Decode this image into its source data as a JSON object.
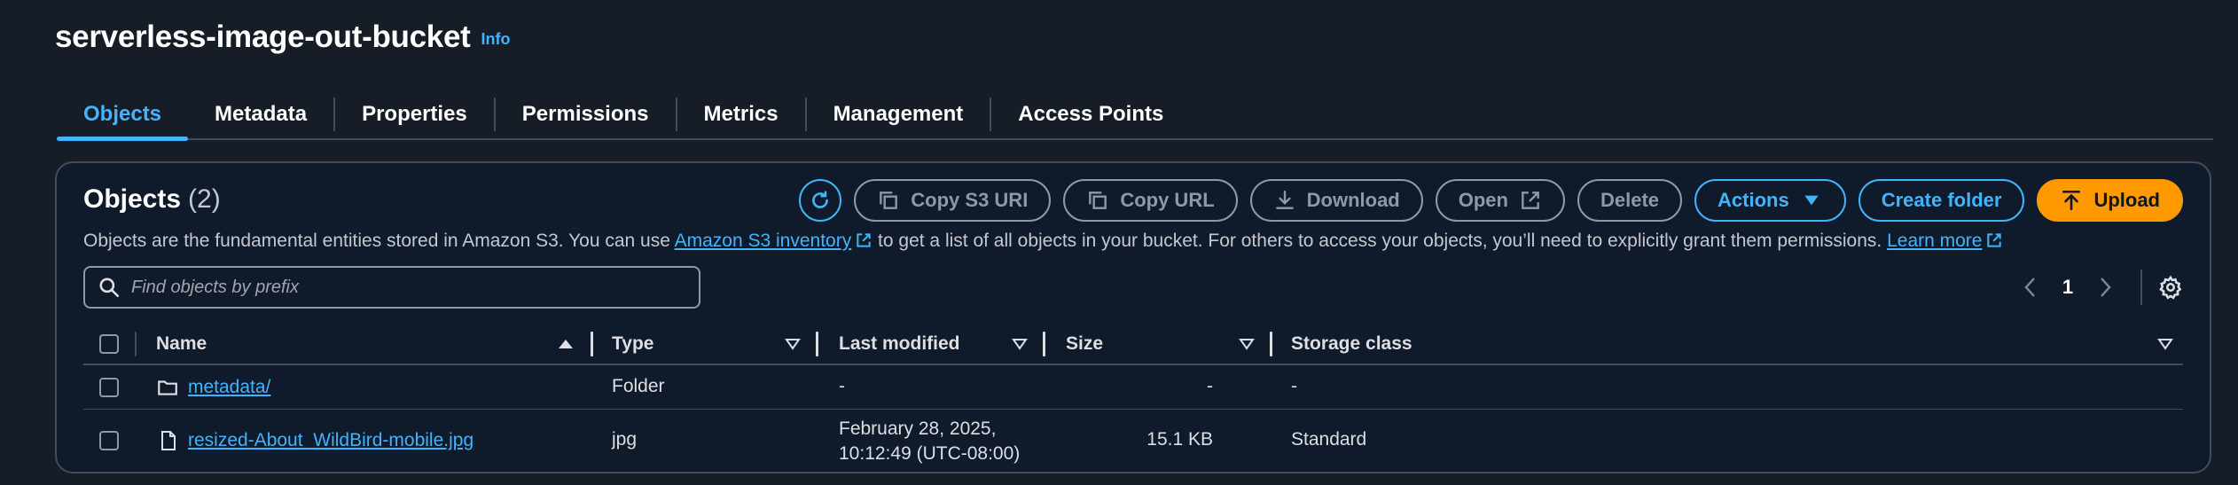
{
  "bucket": {
    "name": "serverless-image-out-bucket",
    "info_label": "Info"
  },
  "tabs": [
    {
      "label": "Objects",
      "active": true
    },
    {
      "label": "Metadata"
    },
    {
      "label": "Properties"
    },
    {
      "label": "Permissions"
    },
    {
      "label": "Metrics"
    },
    {
      "label": "Management"
    },
    {
      "label": "Access Points"
    }
  ],
  "objects_panel": {
    "title": "Objects",
    "count": "(2)",
    "description_before": "Objects are the fundamental entities stored in Amazon S3. You can use ",
    "inventory_link": "Amazon S3 inventory",
    "description_middle": " to get a list of all objects in your bucket. For others to access your objects, you’ll need to explicitly grant them permissions. ",
    "learn_more_link": "Learn more"
  },
  "toolbar": {
    "refresh_icon": "refresh-icon",
    "copy_s3_uri": "Copy S3 URI",
    "copy_url": "Copy URL",
    "download": "Download",
    "open": "Open",
    "delete": "Delete",
    "actions": "Actions",
    "create_folder": "Create folder",
    "upload": "Upload"
  },
  "search": {
    "placeholder": "Find objects by prefix",
    "value": ""
  },
  "pagination": {
    "current_page": "1"
  },
  "table": {
    "columns": [
      "Name",
      "Type",
      "Last modified",
      "Size",
      "Storage class"
    ],
    "rows": [
      {
        "icon": "folder-icon",
        "name": "metadata/",
        "type": "Folder",
        "last_modified_line1": "-",
        "last_modified_line2": "",
        "size": "-",
        "storage_class": "-"
      },
      {
        "icon": "file-icon",
        "name": "resized-About_WildBird-mobile.jpg",
        "type": "jpg",
        "last_modified_line1": "February 28, 2025,",
        "last_modified_line2": "10:12:49 (UTC-08:00)",
        "size": "15.1 KB",
        "storage_class": "Standard"
      }
    ]
  },
  "colors": {
    "accent": "#42b4ff",
    "primary_button": "#ff9900",
    "background": "#161d26",
    "panel": "#0f1b2a",
    "border": "#414d5c"
  }
}
